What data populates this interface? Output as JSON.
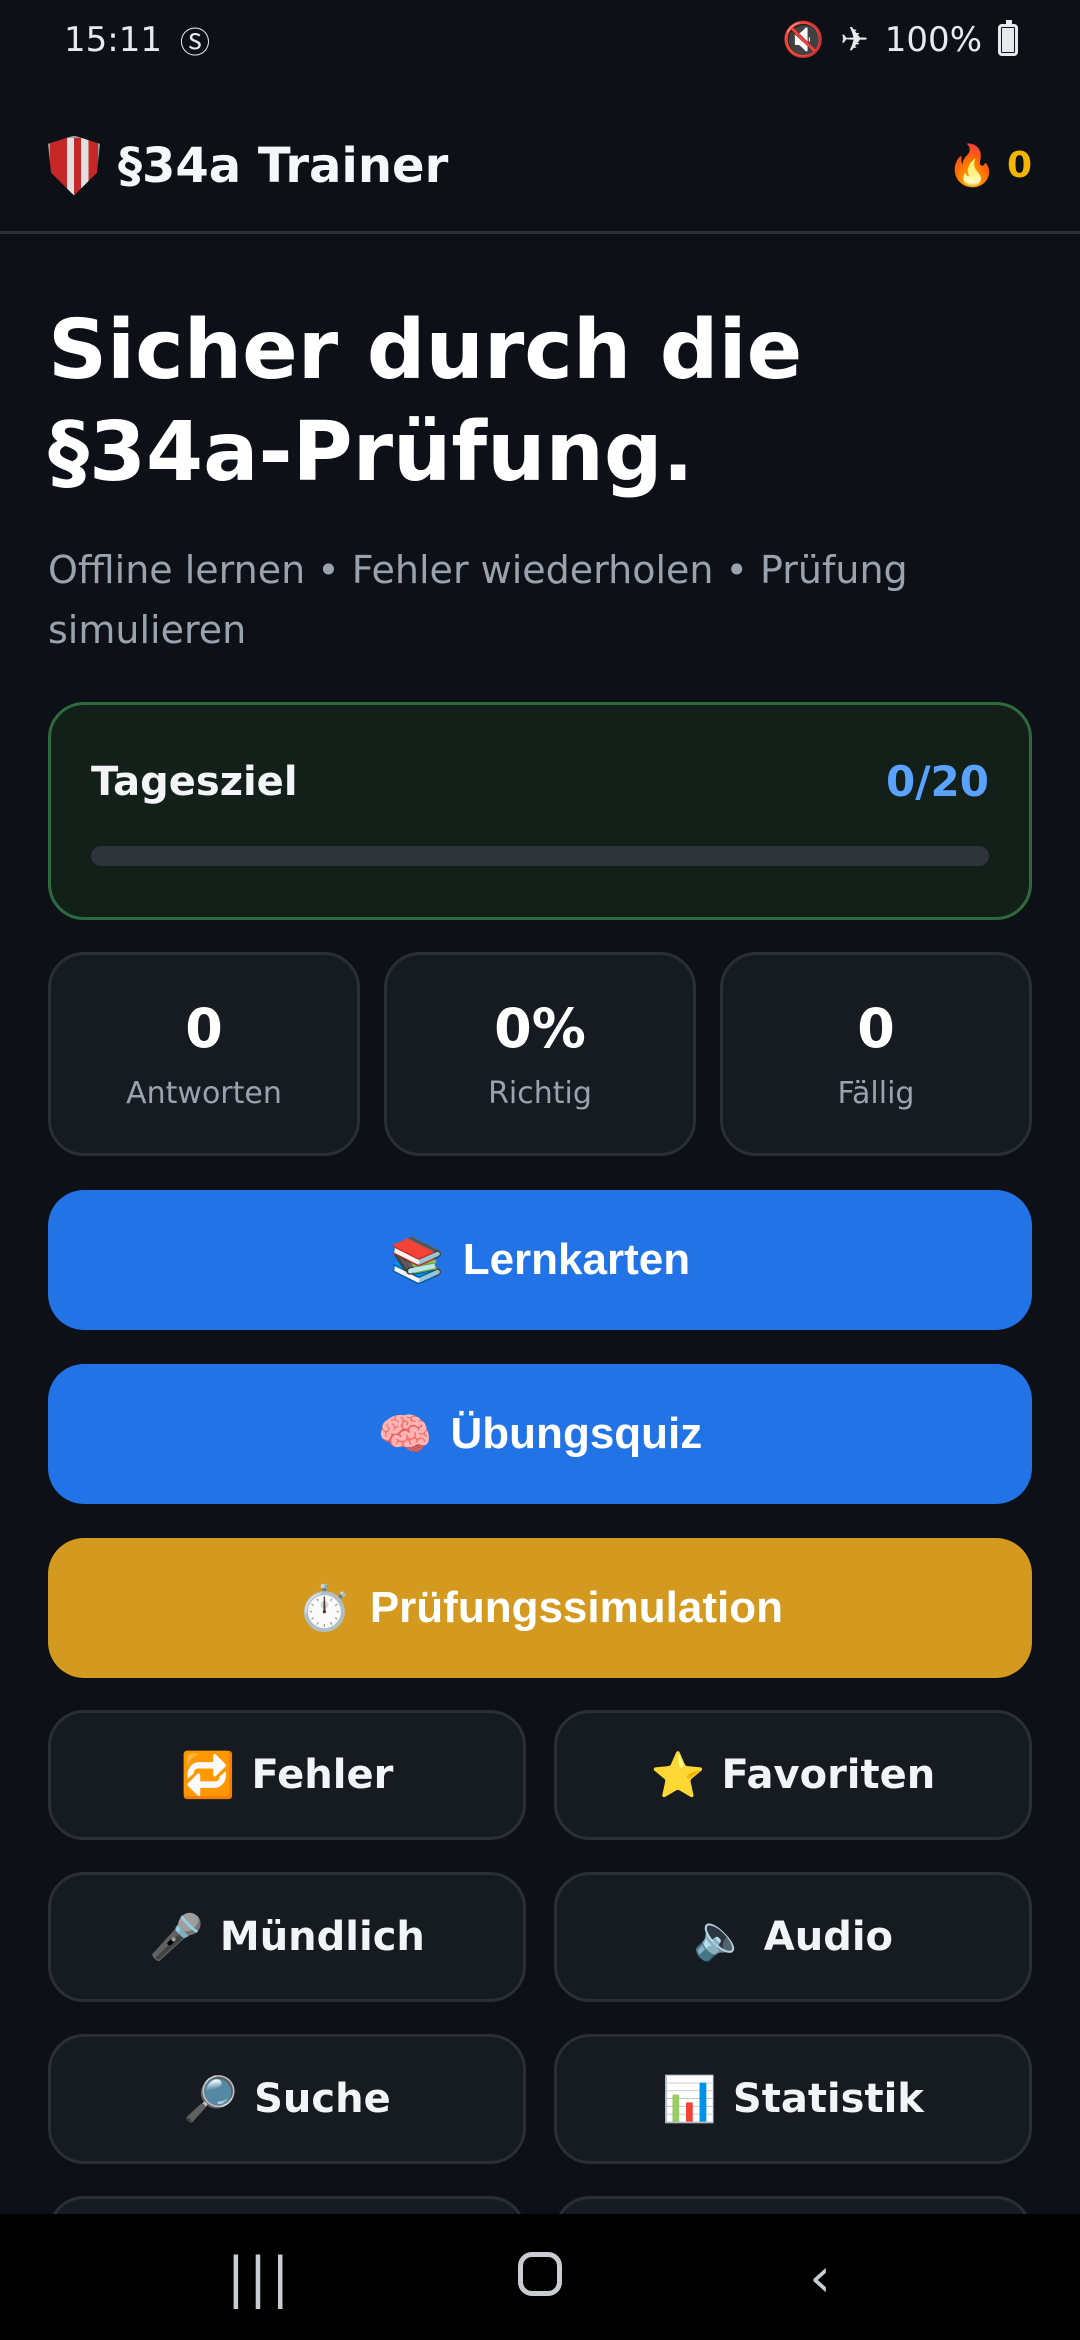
{
  "status_bar": {
    "time": "15:11",
    "battery": "100%",
    "icons": [
      "s-notification-icon",
      "mute-icon",
      "airplane-icon",
      "battery-icon"
    ]
  },
  "app_bar": {
    "title": "§34a Trainer",
    "streak_count": "0",
    "icons": {
      "logo": "shield-icon",
      "streak": "flame-icon"
    }
  },
  "hero": {
    "title": "Sicher durch die §34a-Prüfung.",
    "subtitle": "Offline lernen • Fehler wiederholen • Prüfung simulieren"
  },
  "daily_goal": {
    "label": "Tagesziel",
    "value": "0/20",
    "progress": 0
  },
  "stats": [
    {
      "value": "0",
      "label": "Antworten"
    },
    {
      "value": "0%",
      "label": "Richtig"
    },
    {
      "value": "0",
      "label": "Fällig"
    }
  ],
  "main_actions": {
    "flashcards": {
      "icon": "📚",
      "label": "Lernkarten"
    },
    "quiz": {
      "icon": "🧠",
      "label": "Übungsquiz"
    },
    "exam": {
      "icon": "⏱️",
      "label": "Prüfungssimulation"
    }
  },
  "grid_actions": [
    {
      "icon": "🔁",
      "label": "Fehler"
    },
    {
      "icon": "⭐",
      "label": "Favoriten"
    },
    {
      "icon": "🎤",
      "label": "Mündlich"
    },
    {
      "icon": "🔈",
      "label": "Audio"
    },
    {
      "icon": "🔎",
      "label": "Suche"
    },
    {
      "icon": "📊",
      "label": "Statistik"
    }
  ],
  "nav": {
    "recents": "|||",
    "back": "‹"
  },
  "colors": {
    "background": "#0d1117",
    "primary": "#2173e6",
    "gold": "#d4991f",
    "goal_value": "#5aa2ff",
    "streak": "#f5b400"
  }
}
